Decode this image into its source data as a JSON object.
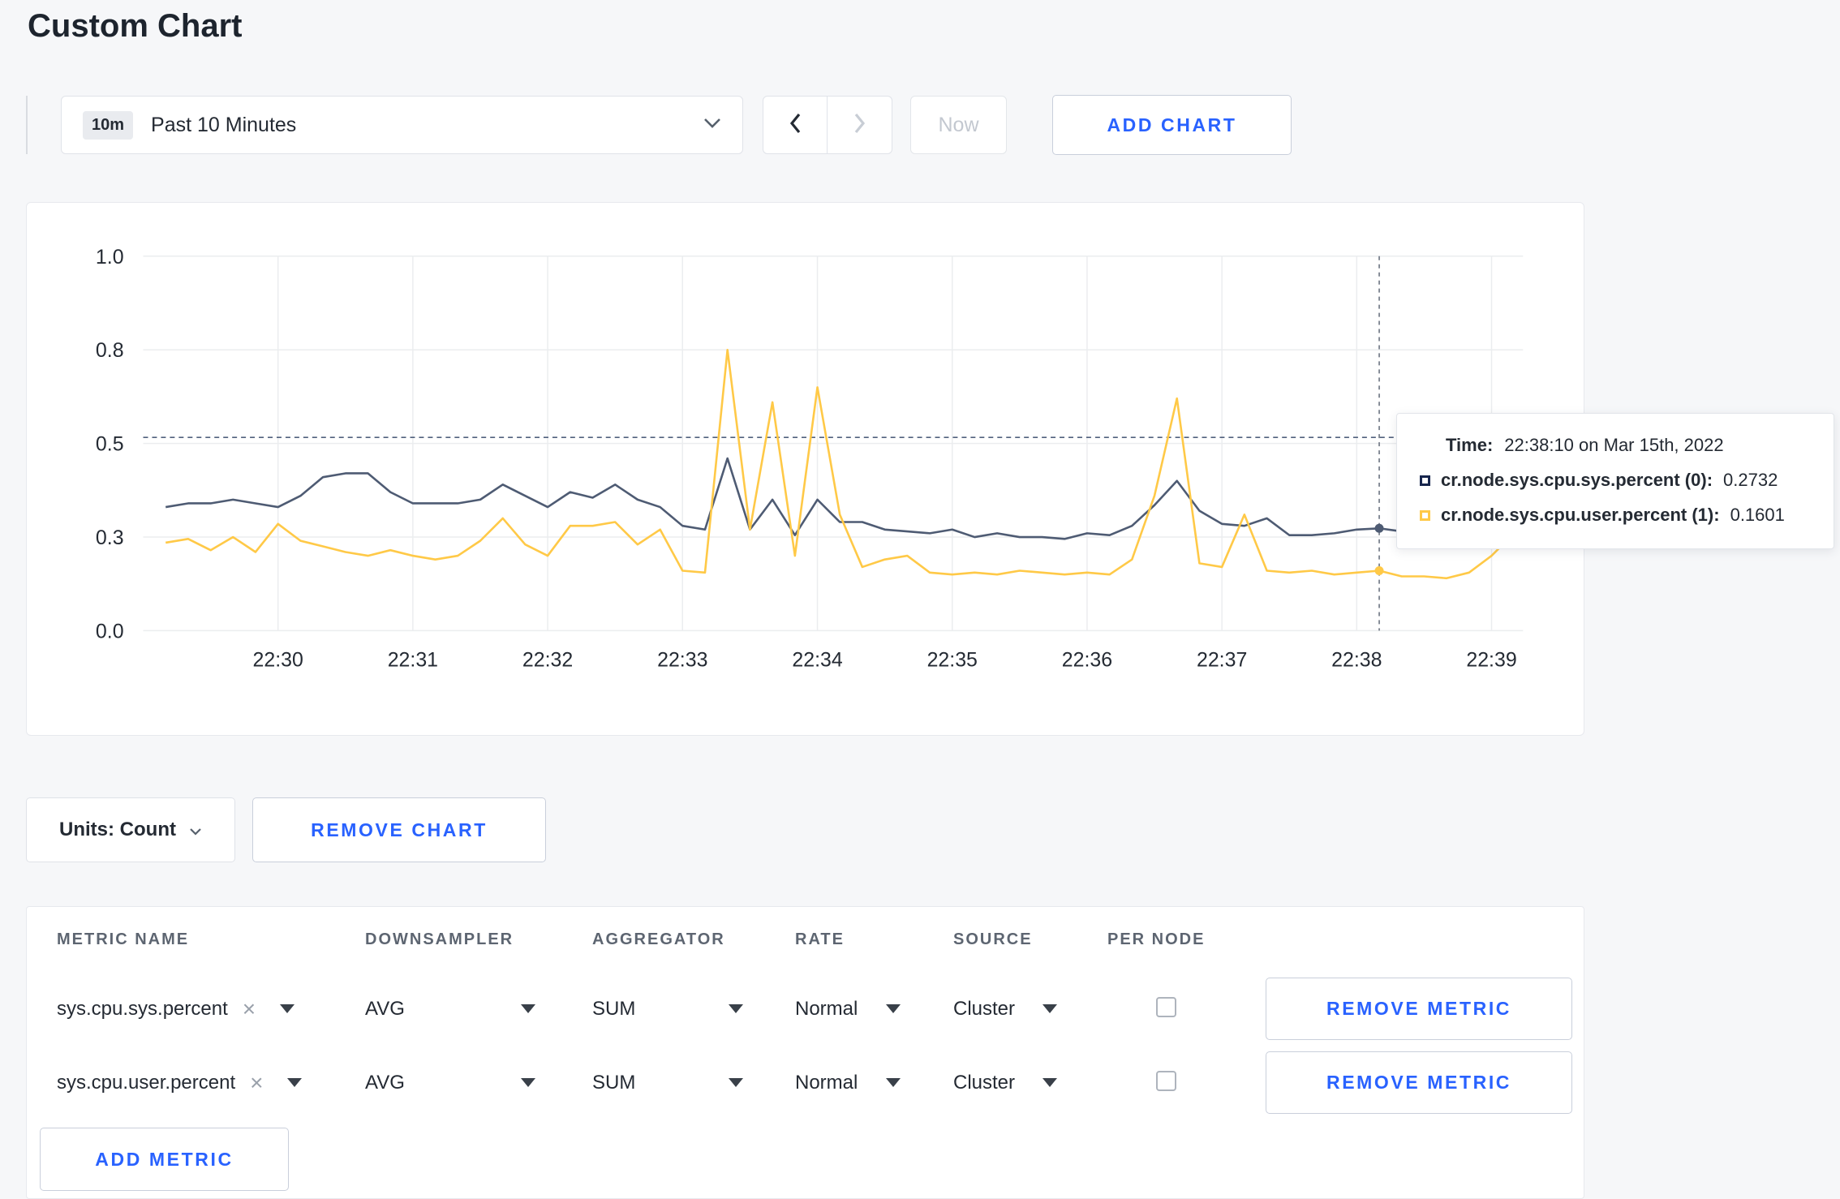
{
  "colors": {
    "accent_blue": "#2962ff",
    "page_bg": "#f6f7f9",
    "series_sys": "#4e5b73",
    "series_user": "#ffc947"
  },
  "header": {
    "title": "Custom Chart"
  },
  "toolbar": {
    "range_badge": "10m",
    "range_label": "Past 10 Minutes",
    "now_label": "Now",
    "add_chart_label": "ADD CHART"
  },
  "tooltip": {
    "time_label": "Time:",
    "time_value": "22:38:10 on Mar 15th, 2022",
    "rows": [
      {
        "name": "cr.node.sys.cpu.sys.percent (0):",
        "value": "0.2732",
        "swatch": "#17264d"
      },
      {
        "name": "cr.node.sys.cpu.user.percent (1):",
        "value": "0.1601",
        "swatch": "#ffc947"
      }
    ]
  },
  "units_bar": {
    "units_label": "Units: Count",
    "remove_chart_label": "REMOVE CHART"
  },
  "metrics": {
    "headers": [
      "METRIC NAME",
      "DOWNSAMPLER",
      "AGGREGATOR",
      "RATE",
      "SOURCE",
      "PER NODE"
    ],
    "rows": [
      {
        "metric": "sys.cpu.sys.percent",
        "downsampler": "AVG",
        "aggregator": "SUM",
        "rate": "Normal",
        "source": "Cluster",
        "per_node_checked": false,
        "remove_label": "REMOVE METRIC"
      },
      {
        "metric": "sys.cpu.user.percent",
        "downsampler": "AVG",
        "aggregator": "SUM",
        "rate": "Normal",
        "source": "Cluster",
        "per_node_checked": false,
        "remove_label": "REMOVE METRIC"
      }
    ],
    "add_metric_label": "ADD METRIC"
  },
  "chart_data": {
    "type": "line",
    "title": "",
    "xlabel": "",
    "ylabel": "",
    "ylim": [
      0,
      1
    ],
    "x_base_time": "22:29:00",
    "x_domain_seconds": [
      0,
      614
    ],
    "yticks": [
      {
        "v": 0,
        "label": "0.0"
      },
      {
        "v": 0.25,
        "label": "0.3"
      },
      {
        "v": 0.5,
        "label": "0.5"
      },
      {
        "v": 0.75,
        "label": "0.8"
      },
      {
        "v": 1,
        "label": "1.0"
      }
    ],
    "xticks": [
      {
        "t": 60,
        "label": "22:30"
      },
      {
        "t": 120,
        "label": "22:31"
      },
      {
        "t": 180,
        "label": "22:32"
      },
      {
        "t": 240,
        "label": "22:33"
      },
      {
        "t": 300,
        "label": "22:34"
      },
      {
        "t": 360,
        "label": "22:35"
      },
      {
        "t": 420,
        "label": "22:36"
      },
      {
        "t": 480,
        "label": "22:37"
      },
      {
        "t": 540,
        "label": "22:38"
      },
      {
        "t": 600,
        "label": "22:39"
      }
    ],
    "t_seconds": [
      10,
      20,
      30,
      40,
      50,
      60,
      70,
      80,
      90,
      100,
      110,
      120,
      130,
      140,
      150,
      160,
      170,
      180,
      190,
      200,
      210,
      220,
      230,
      240,
      250,
      260,
      270,
      280,
      290,
      300,
      310,
      320,
      330,
      340,
      350,
      360,
      370,
      380,
      390,
      400,
      410,
      420,
      430,
      440,
      450,
      460,
      470,
      480,
      490,
      500,
      510,
      520,
      530,
      540,
      550,
      560,
      570,
      580,
      590,
      600,
      610,
      614
    ],
    "series": [
      {
        "name": "cr.node.sys.cpu.sys.percent",
        "color": "#4e5b73",
        "values": [
          0.33,
          0.34,
          0.34,
          0.35,
          0.34,
          0.33,
          0.36,
          0.41,
          0.42,
          0.42,
          0.37,
          0.34,
          0.34,
          0.34,
          0.35,
          0.39,
          0.36,
          0.33,
          0.37,
          0.355,
          0.39,
          0.35,
          0.33,
          0.28,
          0.27,
          0.46,
          0.27,
          0.35,
          0.255,
          0.35,
          0.29,
          0.29,
          0.27,
          0.265,
          0.26,
          0.27,
          0.25,
          0.26,
          0.25,
          0.25,
          0.245,
          0.26,
          0.255,
          0.28,
          0.335,
          0.4,
          0.32,
          0.285,
          0.28,
          0.3,
          0.255,
          0.255,
          0.26,
          0.27,
          0.2732,
          0.265,
          0.26,
          0.285,
          0.27,
          0.27,
          0.28,
          0.27
        ]
      },
      {
        "name": "cr.node.sys.cpu.user.percent",
        "color": "#ffc947",
        "values": [
          0.235,
          0.245,
          0.215,
          0.25,
          0.21,
          0.285,
          0.24,
          0.225,
          0.21,
          0.2,
          0.215,
          0.2,
          0.19,
          0.2,
          0.24,
          0.3,
          0.23,
          0.2,
          0.28,
          0.28,
          0.29,
          0.23,
          0.27,
          0.16,
          0.155,
          0.75,
          0.27,
          0.61,
          0.2,
          0.65,
          0.31,
          0.17,
          0.19,
          0.2,
          0.155,
          0.15,
          0.155,
          0.15,
          0.16,
          0.155,
          0.15,
          0.155,
          0.15,
          0.19,
          0.36,
          0.62,
          0.18,
          0.17,
          0.31,
          0.16,
          0.155,
          0.16,
          0.15,
          0.155,
          0.1601,
          0.145,
          0.145,
          0.14,
          0.155,
          0.2,
          0.26,
          0.225
        ]
      }
    ],
    "crosshair": {
      "t": 550,
      "time_label": "22:38:10",
      "hline_value": 0.516
    },
    "legend_position": "tooltip",
    "grid": true
  }
}
